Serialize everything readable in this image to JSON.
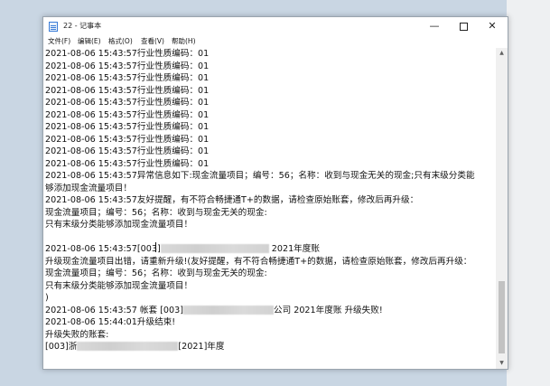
{
  "window": {
    "title": "22 - 记事本",
    "minimize": "—",
    "close": "✕"
  },
  "menu": [
    "文件(F)",
    "编辑(E)",
    "格式(O)",
    "查看(V)",
    "帮助(H)"
  ],
  "lines": [
    "2021-08-06 15:43:57行业性质编码：01",
    "2021-08-06 15:43:57行业性质编码：01",
    "2021-08-06 15:43:57行业性质编码：01",
    "2021-08-06 15:43:57行业性质编码：01",
    "2021-08-06 15:43:57行业性质编码：01",
    "2021-08-06 15:43:57行业性质编码：01",
    "2021-08-06 15:43:57行业性质编码：01",
    "2021-08-06 15:43:57行业性质编码：01",
    "2021-08-06 15:43:57行业性质编码：01",
    "2021-08-06 15:43:57行业性质编码：01",
    "2021-08-06 15:43:57异常信息如下:现金流量项目；编号：56；名称：收到与现金无关的现金;只有末级分类能",
    "够添加现金流量项目！",
    "2021-08-06 15:43:57友好提醒，有不符合畅捷通T+的数据，请检查原始账套，修改后再升级：",
    "现金流量项目；编号：56；名称：收到与现金无关的现金:",
    "只有末级分类能够添加现金流量项目！",
    "",
    "2021-08-06 15:43:57[003]",
    "升级现金流量项目出错，请重新升级!(友好提醒，有不符合畅捷通T+的数据，请检查原始账套，修改后再升级：",
    "现金流量项目；编号：56；名称：收到与现金无关的现金:",
    "只有末级分类能够添加现金流量项目！",
    ")",
    "2021-08-06 15:43:57 帐套 [003]",
    "2021-08-06 15:44:01升级结束!",
    "升级失败的账套:",
    "[003]浙"
  ],
  "redacted_tails": {
    "line16": "2021年度账",
    "line21": "公司 2021年度账 升级失败!",
    "line24": "[2021]年度"
  }
}
